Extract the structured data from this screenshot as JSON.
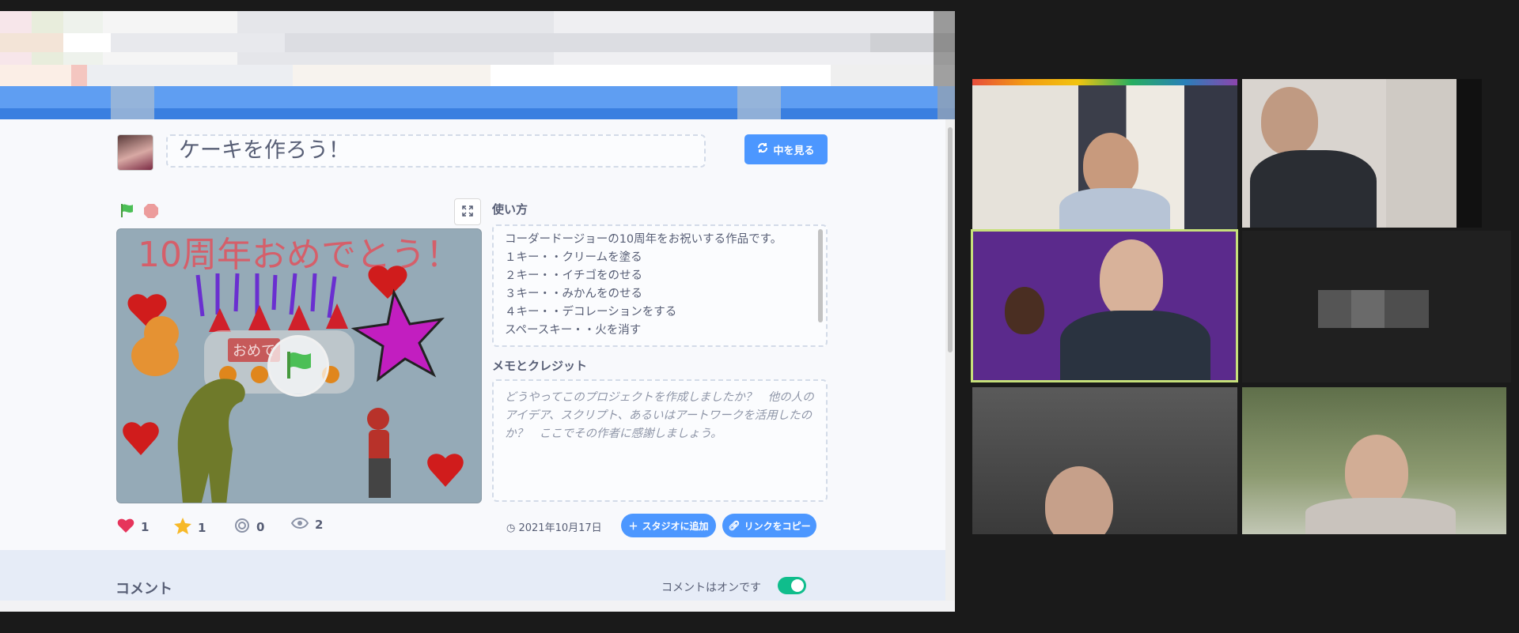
{
  "project": {
    "title": "ケーキを作ろう！",
    "see_inside_label": "中を見る",
    "stage_title": "10周年おめでとう！",
    "stage_cake_label": "おめで",
    "instructions_heading": "使い方",
    "instructions_lines": [
      "コーダードージョーの10周年をお祝いする作品です。",
      "１キー・・クリームを塗る",
      "２キー・・イチゴをのせる",
      "３キー・・みかんをのせる",
      "４キー・・デコレーションをする",
      "スペースキー・・火を消す"
    ],
    "notes_heading": "メモとクレジット",
    "notes_placeholder": "どうやってこのプロジェクトを作成しましたか？　他の人のアイデア、スクリプト、あるいはアートワークを活用したのか？　ここでその作者に感謝しましょう。",
    "stats": {
      "loves": "1",
      "favorites": "1",
      "remixes": "0",
      "views": "2"
    },
    "date": "2021年10月17日",
    "add_to_studio_label": "スタジオに追加",
    "copy_link_label": "リンクをコピー"
  },
  "comments": {
    "title": "コメント",
    "status": "コメントはオンです",
    "enabled": true
  },
  "colors": {
    "accent": "#4c97ff",
    "toggle_on": "#0fbd8c",
    "active_speaker_border": "#c6e07a"
  },
  "video_tiles": [
    {
      "name": "participant-1"
    },
    {
      "name": "participant-2"
    },
    {
      "name": "participant-3",
      "active": true
    },
    {
      "name": "participant-4",
      "camera_off": true
    },
    {
      "name": "participant-5"
    },
    {
      "name": "participant-6"
    }
  ]
}
